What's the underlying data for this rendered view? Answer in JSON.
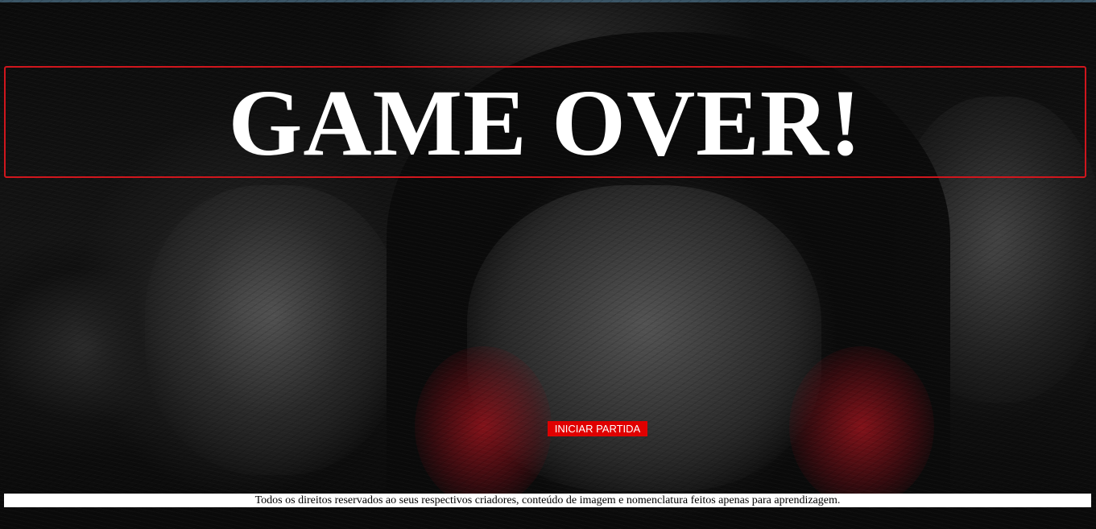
{
  "title": {
    "text": "GAME OVER!"
  },
  "start_button": {
    "label": "INICIAR PARTIDA"
  },
  "footer": {
    "text": "Todos os direitos reservados ao seus respectivos criadores, conteúdo de imagem e nomenclatura feitos apenas para aprendizagem."
  },
  "colors": {
    "accent_red": "#d0161d",
    "button_red": "#e00000",
    "title_text": "#ffffff",
    "footer_bg": "#ffffff"
  },
  "background": {
    "description_icon": "hooded-figure-image"
  }
}
